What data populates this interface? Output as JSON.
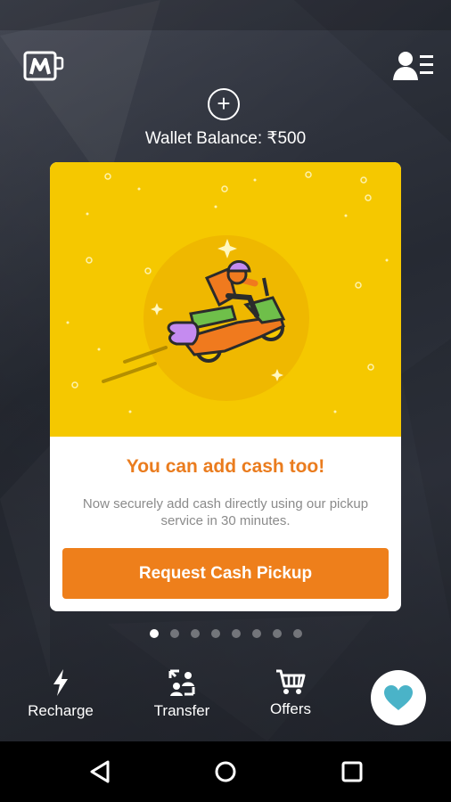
{
  "header": {
    "logo_icon": "mobikwik-logo-icon",
    "profile_menu_icon": "profile-menu-icon",
    "add_money_symbol": "+",
    "wallet_balance": "Wallet Balance: ₹500"
  },
  "promo_card": {
    "title": "You can add cash too!",
    "description": "Now securely add cash directly using our pickup service in 30 minutes.",
    "cta_label": "Request Cash Pickup",
    "illustration": "delivery-scooter-icon"
  },
  "carousel": {
    "total_pages": 8,
    "active_index": 0
  },
  "bottom_nav": {
    "items": [
      {
        "label": "Recharge",
        "icon": "lightning-icon"
      },
      {
        "label": "Transfer",
        "icon": "transfer-icon"
      },
      {
        "label": "Offers",
        "icon": "cart-icon"
      }
    ],
    "favorite_icon": "heart-icon"
  },
  "system_nav": {
    "back": "back-icon",
    "home": "home-icon",
    "recents": "recents-icon"
  },
  "colors": {
    "accent_orange": "#ee7f1b",
    "title_orange": "#ea7c1e",
    "hero_yellow": "#f5c800",
    "heart_teal": "#4ab3c8"
  }
}
